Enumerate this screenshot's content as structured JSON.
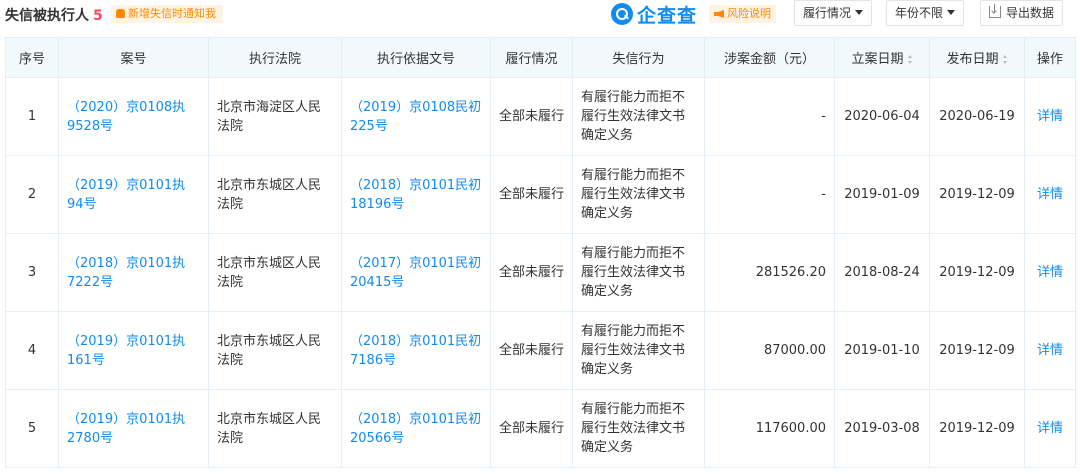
{
  "header": {
    "title": "失信被执行人",
    "count": "5",
    "notice": "新增失信时通知我",
    "brand": "企查查",
    "risk_label": "风险说明",
    "filter_performance": "履行情况",
    "filter_year": "年份不限",
    "export_label": "导出数据"
  },
  "table": {
    "columns": [
      "序号",
      "案号",
      "执行法院",
      "执行依据文号",
      "履行情况",
      "失信行为",
      "涉案金额（元）",
      "立案日期",
      "发布日期",
      "操作"
    ],
    "rows": [
      {
        "index": "1",
        "case_no": "（2020）京0108执9528号",
        "court": "北京市海淀区人民法院",
        "basis_no": "（2019）京0108民初225号",
        "performance": "全部未履行",
        "behavior": "有履行能力而拒不履行生效法律文书确定义务",
        "amount": "-",
        "filed_date": "2020-06-04",
        "publish_date": "2020-06-19",
        "action": "详情"
      },
      {
        "index": "2",
        "case_no": "（2019）京0101执94号",
        "court": "北京市东城区人民法院",
        "basis_no": "（2018）京0101民初18196号",
        "performance": "全部未履行",
        "behavior": "有履行能力而拒不履行生效法律文书确定义务",
        "amount": "-",
        "filed_date": "2019-01-09",
        "publish_date": "2019-12-09",
        "action": "详情"
      },
      {
        "index": "3",
        "case_no": "（2018）京0101执7222号",
        "court": "北京市东城区人民法院",
        "basis_no": "（2017）京0101民初20415号",
        "performance": "全部未履行",
        "behavior": "有履行能力而拒不履行生效法律文书确定义务",
        "amount": "281526.20",
        "filed_date": "2018-08-24",
        "publish_date": "2019-12-09",
        "action": "详情"
      },
      {
        "index": "4",
        "case_no": "（2019）京0101执161号",
        "court": "北京市东城区人民法院",
        "basis_no": "（2018）京0101民初7186号",
        "performance": "全部未履行",
        "behavior": "有履行能力而拒不履行生效法律文书确定义务",
        "amount": "87000.00",
        "filed_date": "2019-01-10",
        "publish_date": "2019-12-09",
        "action": "详情"
      },
      {
        "index": "5",
        "case_no": "（2019）京0101执2780号",
        "court": "北京市东城区人民法院",
        "basis_no": "（2018）京0101民初20566号",
        "performance": "全部未履行",
        "behavior": "有履行能力而拒不履行生效法律文书确定义务",
        "amount": "117600.00",
        "filed_date": "2019-03-08",
        "publish_date": "2019-12-09",
        "action": "详情"
      }
    ]
  },
  "colors": {
    "accent": "#128BED",
    "count": "#FD485E",
    "notice_bg": "#FFF3E3",
    "notice_text": "#FF8A00",
    "header_bg": "#F2F9FC",
    "border": "#E4EEF6"
  },
  "icons": {
    "notice": "bell-icon",
    "risk": "speaker-icon",
    "export": "download-icon",
    "brand": "magnifier-logo-icon"
  }
}
